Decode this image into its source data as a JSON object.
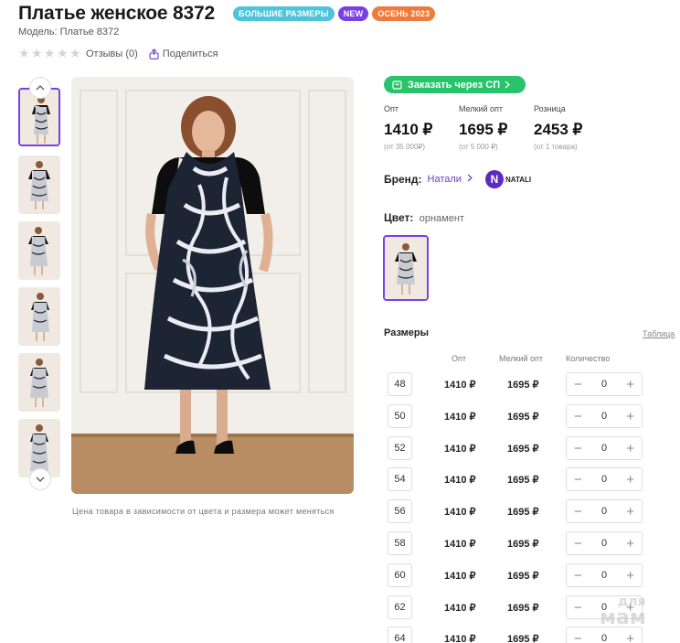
{
  "product": {
    "title": "Платье женское 8372",
    "model": "Модель: Платье 8372",
    "reviews": "Отзывы (0)",
    "share": "Поделиться",
    "badges": [
      {
        "label": "БОЛЬШИЕ РАЗМЕРЫ",
        "color": "#4fc3d9"
      },
      {
        "label": "NEW",
        "color": "#7b3fe4"
      },
      {
        "label": "ОСЕНЬ 2023",
        "color": "#f07a3c"
      }
    ],
    "photo_caption": "Цена товара в зависимости от цвета и размера может меняться"
  },
  "order": {
    "sp_button": "Заказать через СП",
    "sp_color": "#27c46b"
  },
  "prices": [
    {
      "label": "Опт",
      "value": "1410 ₽",
      "note": "(от 35 000₽)"
    },
    {
      "label": "Мелкий опт",
      "value": "1695 ₽",
      "note": "(от 5 000 ₽)"
    },
    {
      "label": "Розница",
      "value": "2453 ₽",
      "note": "(от 1 товара)"
    }
  ],
  "brand": {
    "label": "Бренд:",
    "name": "Натали",
    "logo_letter": "N",
    "logo_text": "NATALI"
  },
  "color": {
    "label": "Цвет:",
    "value": "орнамент"
  },
  "sizes": {
    "title": "Размеры",
    "table_link": "Таблица",
    "headers": {
      "opt": "Опт",
      "small_opt": "Мелкий опт",
      "qty": "Количество"
    },
    "rows": [
      {
        "size": "48",
        "opt": "1410 ₽",
        "small_opt": "1695 ₽",
        "qty": "0"
      },
      {
        "size": "50",
        "opt": "1410 ₽",
        "small_opt": "1695 ₽",
        "qty": "0"
      },
      {
        "size": "52",
        "opt": "1410 ₽",
        "small_opt": "1695 ₽",
        "qty": "0"
      },
      {
        "size": "54",
        "opt": "1410 ₽",
        "small_opt": "1695 ₽",
        "qty": "0"
      },
      {
        "size": "56",
        "opt": "1410 ₽",
        "small_opt": "1695 ₽",
        "qty": "0"
      },
      {
        "size": "58",
        "opt": "1410 ₽",
        "small_opt": "1695 ₽",
        "qty": "0"
      },
      {
        "size": "60",
        "opt": "1410 ₽",
        "small_opt": "1695 ₽",
        "qty": "0"
      },
      {
        "size": "62",
        "opt": "1410 ₽",
        "small_opt": "1695 ₽",
        "qty": "0"
      },
      {
        "size": "64",
        "opt": "1410 ₽",
        "small_opt": "1695 ₽",
        "qty": "0"
      }
    ]
  },
  "watermark": {
    "line1": "для",
    "line2": "мам"
  }
}
